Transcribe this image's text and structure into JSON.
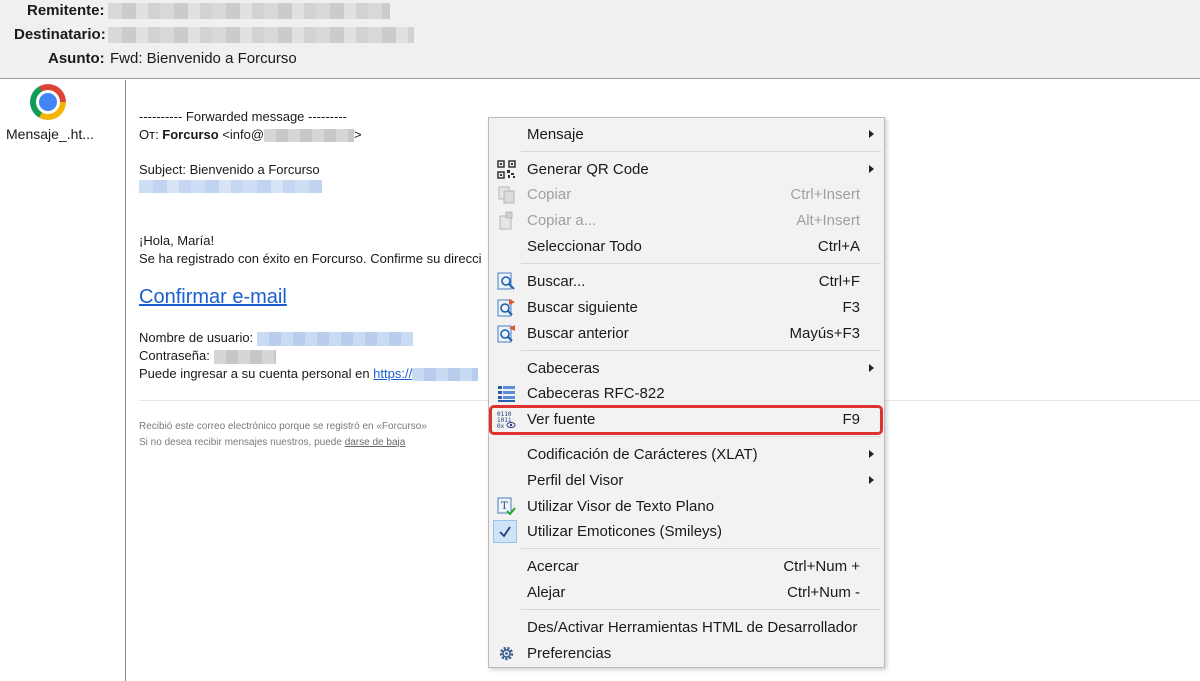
{
  "header": {
    "from_label": "Remitente:",
    "to_label": "Destinatario:",
    "subject_label": "Asunto:",
    "subject_value": "Fwd: Bienvenido a Forcurso"
  },
  "attachment": {
    "icon": "chrome-icon",
    "name": "Mensaje_.ht..."
  },
  "message": {
    "forwarded": "---------- Forwarded message ---------",
    "from_prefix": "От: ",
    "from_name": "Forcurso",
    "from_email_start": "<info@",
    "from_email_end": ">",
    "subject_line": "Subject: Bienvenido a Forcurso",
    "greeting": "¡Hola, María!",
    "registered": "Se ha registrado con éxito en Forcurso. Confirme su direcci",
    "confirm_link": "Confirmar e-mail",
    "username_label": "Nombre de usuario: ",
    "password_label": "Contraseña:",
    "login_text": "Puede ingresar a su cuenta personal en ",
    "login_link": "https://",
    "footer_line1": "Recibió este correo electrónico porque se registró en «Forcurso»",
    "footer_line2_prefix": "Si no desea recibir mensajes nuestros, puede ",
    "footer_unsubscribe": "darse de baja"
  },
  "context_menu": {
    "items": [
      {
        "label": "Mensaje",
        "shortcut": "",
        "submenu": true
      },
      {
        "label": "Generar QR Code",
        "shortcut": "",
        "submenu": true,
        "icon": "qr-code-icon"
      },
      {
        "label": "Copiar",
        "shortcut": "Ctrl+Insert",
        "disabled": true,
        "icon": "copy-icon"
      },
      {
        "label": "Copiar a...",
        "shortcut": "Alt+Insert",
        "disabled": true,
        "icon": "copy-to-icon"
      },
      {
        "label": "Seleccionar Todo",
        "shortcut": "Ctrl+A"
      },
      {
        "label": "Buscar...",
        "shortcut": "Ctrl+F",
        "icon": "search-icon"
      },
      {
        "label": "Buscar siguiente",
        "shortcut": "F3",
        "icon": "search-next-icon"
      },
      {
        "label": "Buscar anterior",
        "shortcut": "Mayús+F3",
        "icon": "search-previous-icon"
      },
      {
        "label": "Cabeceras",
        "shortcut": "",
        "submenu": true
      },
      {
        "label": "Cabeceras RFC-822",
        "shortcut": "",
        "icon": "headers-list-icon"
      },
      {
        "label": "Ver fuente",
        "shortcut": "F9",
        "icon": "binary-source-icon",
        "highlighted": true
      },
      {
        "label": "Codificación de Carácteres (XLAT)",
        "shortcut": "",
        "submenu": true
      },
      {
        "label": "Perfil del Visor",
        "shortcut": "",
        "submenu": true
      },
      {
        "label": "Utilizar Visor de Texto Plano",
        "shortcut": "",
        "icon": "plain-text-icon"
      },
      {
        "label": "Utilizar Emoticones (Smileys)",
        "shortcut": "",
        "checked": true,
        "icon": "checkmark-icon"
      },
      {
        "label": "Acercar",
        "shortcut": "Ctrl+Num +"
      },
      {
        "label": "Alejar",
        "shortcut": "Ctrl+Num -"
      },
      {
        "label": "Des/Activar Herramientas HTML de Desarrollador",
        "shortcut": ""
      },
      {
        "label": "Preferencias",
        "shortcut": "",
        "icon": "gear-icon"
      }
    ]
  },
  "colors": {
    "highlight_border": "#e03131",
    "link": "#1a5fd0",
    "checked_bg": "#cde4f7"
  }
}
